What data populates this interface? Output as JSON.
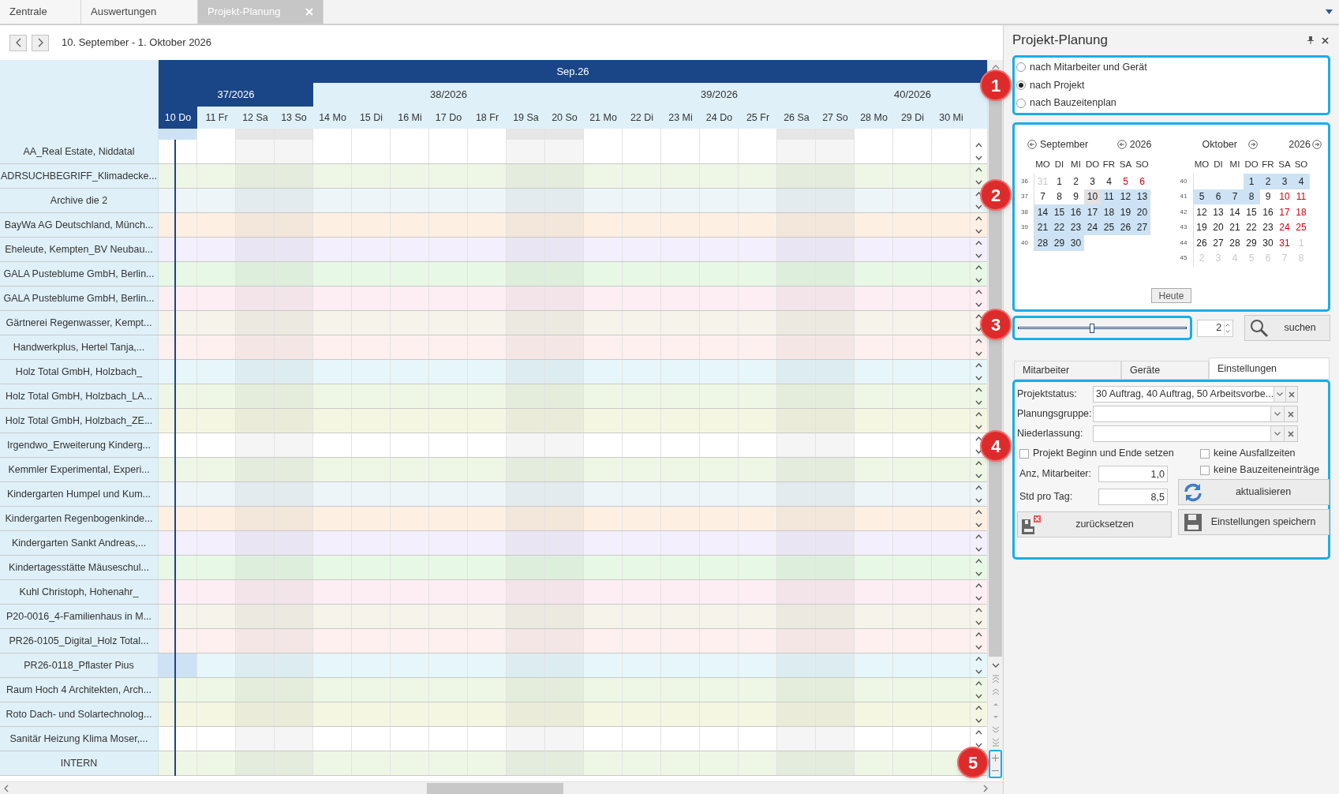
{
  "tabs": [
    {
      "label": "Zentrale",
      "selected": false
    },
    {
      "label": "Auswertungen",
      "selected": false
    },
    {
      "label": "Projekt-Planung",
      "selected": true
    }
  ],
  "toolbar": {
    "range": "10. September - 1. Oktober 2026"
  },
  "gantt": {
    "month": "Sep.26",
    "weeks": [
      {
        "label": "37/2026",
        "current": true,
        "days": [
          {
            "label": "10 Do",
            "weekend": false,
            "today": true
          },
          {
            "label": "11 Fr",
            "weekend": false,
            "today": false
          },
          {
            "label": "12 Sa",
            "weekend": true,
            "today": false
          },
          {
            "label": "13 So",
            "weekend": true,
            "today": false
          }
        ]
      },
      {
        "label": "38/2026",
        "current": false,
        "days": [
          {
            "label": "14 Mo",
            "weekend": false,
            "today": false
          },
          {
            "label": "15 Di",
            "weekend": false,
            "today": false
          },
          {
            "label": "16 Mi",
            "weekend": false,
            "today": false
          },
          {
            "label": "17 Do",
            "weekend": false,
            "today": false
          },
          {
            "label": "18 Fr",
            "weekend": false,
            "today": false
          },
          {
            "label": "19 Sa",
            "weekend": true,
            "today": false
          },
          {
            "label": "20 So",
            "weekend": true,
            "today": false
          }
        ]
      },
      {
        "label": "39/2026",
        "current": false,
        "days": [
          {
            "label": "21 Mo",
            "weekend": false,
            "today": false
          },
          {
            "label": "22 Di",
            "weekend": false,
            "today": false
          },
          {
            "label": "23 Mi",
            "weekend": false,
            "today": false
          },
          {
            "label": "24 Do",
            "weekend": false,
            "today": false
          },
          {
            "label": "25 Fr",
            "weekend": false,
            "today": false
          },
          {
            "label": "26 Sa",
            "weekend": true,
            "today": false
          },
          {
            "label": "27 So",
            "weekend": true,
            "today": false
          }
        ]
      },
      {
        "label": "40/2026",
        "current": false,
        "days": [
          {
            "label": "28 Mo",
            "weekend": false,
            "today": false
          },
          {
            "label": "29 Di",
            "weekend": false,
            "today": false
          },
          {
            "label": "30 Mi",
            "weekend": false,
            "today": false
          }
        ]
      }
    ],
    "rows": [
      {
        "name": "AA_Real Estate, Niddatal",
        "color": "#ffffff",
        "selected": false
      },
      {
        "name": "ADRSUCHBEGRIFF_Klimadecke...",
        "color": "#eef6e6",
        "selected": false
      },
      {
        "name": "Archive die 2",
        "color": "#edf5f8",
        "selected": false
      },
      {
        "name": "BayWa AG Deutschland, Münch...",
        "color": "#fdf0e3",
        "selected": false
      },
      {
        "name": "Eheleute, Kempten_BV Neubau...",
        "color": "#f3effc",
        "selected": false
      },
      {
        "name": "GALA Pusteblume GmbH, Berlin...",
        "color": "#e8f8e6",
        "selected": false
      },
      {
        "name": "GALA Pusteblume GmbH, Berlin...",
        "color": "#fdeef3",
        "selected": false
      },
      {
        "name": "Gärtnerei Regenwasser, Kempt...",
        "color": "#f5f3ea",
        "selected": false
      },
      {
        "name": "Handwerkplus, Hertel Tanja,...",
        "color": "#fdf0ee",
        "selected": false
      },
      {
        "name": "Holz Total GmbH, Holzbach_",
        "color": "#e6f6fa",
        "selected": false
      },
      {
        "name": "Holz Total GmbH, Holzbach_LA...",
        "color": "#eef7e5",
        "selected": false
      },
      {
        "name": "Holz Total GmbH, Holzbach_ZE...",
        "color": "#f4f6e2",
        "selected": false
      },
      {
        "name": "Irgendwo_Erweiterung Kinderg...",
        "color": "#ffffff",
        "selected": false
      },
      {
        "name": "Kemmler Experimental, Experi...",
        "color": "#eef6e6",
        "selected": false
      },
      {
        "name": "Kindergarten Humpel und Kum...",
        "color": "#edf5f8",
        "selected": false
      },
      {
        "name": "Kindergarten Regenbogenkinde...",
        "color": "#fdf0e3",
        "selected": false
      },
      {
        "name": "Kindergarten Sankt Andreas,...",
        "color": "#f3effc",
        "selected": false
      },
      {
        "name": "Kindertagesstätte Mäuseschul...",
        "color": "#e8f8e6",
        "selected": false
      },
      {
        "name": "Kuhl Christoph, Hohenahr_",
        "color": "#fdeef3",
        "selected": false
      },
      {
        "name": "P20-0016_4-Familienhaus in M...",
        "color": "#f5f3ea",
        "selected": false
      },
      {
        "name": "PR26-0105_Digital_Holz Total...",
        "color": "#fdf0ee",
        "selected": false
      },
      {
        "name": "PR26-0118_Pflaster Pius",
        "color": "#e6f6fa",
        "selected": true
      },
      {
        "name": "Raum Hoch 4 Architekten, Arch...",
        "color": "#eef7e5",
        "selected": false
      },
      {
        "name": "Roto Dach- und Solartechnolog...",
        "color": "#f4f6e2",
        "selected": false
      },
      {
        "name": "Sanitär Heizung Klima Moser,...",
        "color": "#ffffff",
        "selected": false
      },
      {
        "name": "INTERN",
        "color": "#eef6e6",
        "selected": false
      }
    ]
  },
  "panel": {
    "title": "Projekt-Planung",
    "views": [
      {
        "label": "nach Mitarbeiter und Gerät",
        "selected": false
      },
      {
        "label": "nach Projekt",
        "selected": true
      },
      {
        "label": "nach Bauzeitenplan",
        "selected": false
      }
    ],
    "calendar": {
      "months": [
        {
          "month": "September",
          "year": "2026",
          "weekdays": [
            "MO",
            "DI",
            "MI",
            "DO",
            "FR",
            "SA",
            "SO"
          ],
          "weeks": [
            {
              "week": "36",
              "days": [
                {
                  "t": "31",
                  "kind": "muted",
                  "selected": false
                },
                {
                  "t": "1",
                  "kind": "plain",
                  "selected": false
                },
                {
                  "t": "2",
                  "kind": "plain",
                  "selected": false
                },
                {
                  "t": "3",
                  "kind": "plain",
                  "selected": false
                },
                {
                  "t": "4",
                  "kind": "plain",
                  "selected": false
                },
                {
                  "t": "5",
                  "kind": "weekend",
                  "selected": false
                },
                {
                  "t": "6",
                  "kind": "weekend",
                  "selected": false
                }
              ]
            },
            {
              "week": "37",
              "days": [
                {
                  "t": "7",
                  "kind": "plain",
                  "selected": false
                },
                {
                  "t": "8",
                  "kind": "plain",
                  "selected": false
                },
                {
                  "t": "9",
                  "kind": "plain",
                  "selected": false
                },
                {
                  "t": "10",
                  "kind": "today",
                  "selected": false
                },
                {
                  "t": "11",
                  "kind": "plain",
                  "selected": true
                },
                {
                  "t": "12",
                  "kind": "weekend",
                  "selected": true
                },
                {
                  "t": "13",
                  "kind": "weekend",
                  "selected": true
                }
              ]
            },
            {
              "week": "38",
              "days": [
                {
                  "t": "14",
                  "kind": "plain",
                  "selected": true
                },
                {
                  "t": "15",
                  "kind": "plain",
                  "selected": true
                },
                {
                  "t": "16",
                  "kind": "plain",
                  "selected": true
                },
                {
                  "t": "17",
                  "kind": "plain",
                  "selected": true
                },
                {
                  "t": "18",
                  "kind": "plain",
                  "selected": true
                },
                {
                  "t": "19",
                  "kind": "weekend",
                  "selected": true
                },
                {
                  "t": "20",
                  "kind": "weekend",
                  "selected": true
                }
              ]
            },
            {
              "week": "39",
              "days": [
                {
                  "t": "21",
                  "kind": "plain",
                  "selected": true
                },
                {
                  "t": "22",
                  "kind": "plain",
                  "selected": true
                },
                {
                  "t": "23",
                  "kind": "plain",
                  "selected": true
                },
                {
                  "t": "24",
                  "kind": "plain",
                  "selected": true
                },
                {
                  "t": "25",
                  "kind": "plain",
                  "selected": true
                },
                {
                  "t": "26",
                  "kind": "weekend",
                  "selected": true
                },
                {
                  "t": "27",
                  "kind": "weekend",
                  "selected": true
                }
              ]
            },
            {
              "week": "40",
              "days": [
                {
                  "t": "28",
                  "kind": "plain",
                  "selected": true
                },
                {
                  "t": "29",
                  "kind": "plain",
                  "selected": true
                },
                {
                  "t": "30",
                  "kind": "plain",
                  "selected": true
                }
              ]
            }
          ]
        },
        {
          "month": "Oktober",
          "year": "2026",
          "weekdays": [
            "MO",
            "DI",
            "MI",
            "DO",
            "FR",
            "SA",
            "SO"
          ],
          "weeks": [
            {
              "week": "40",
              "days": [
                {
                  "t": "1",
                  "kind": "plain",
                  "selected": true
                },
                {
                  "t": "2",
                  "kind": "plain",
                  "selected": true
                },
                {
                  "t": "3",
                  "kind": "weekend",
                  "selected": true
                },
                {
                  "t": "4",
                  "kind": "weekend",
                  "selected": true
                }
              ]
            },
            {
              "week": "41",
              "days": [
                {
                  "t": "5",
                  "kind": "plain",
                  "selected": true
                },
                {
                  "t": "6",
                  "kind": "plain",
                  "selected": true
                },
                {
                  "t": "7",
                  "kind": "plain",
                  "selected": true
                },
                {
                  "t": "8",
                  "kind": "plain",
                  "selected": true
                },
                {
                  "t": "9",
                  "kind": "plain",
                  "selected": false
                },
                {
                  "t": "10",
                  "kind": "weekend",
                  "selected": false
                },
                {
                  "t": "11",
                  "kind": "weekend",
                  "selected": false
                }
              ]
            },
            {
              "week": "42",
              "days": [
                {
                  "t": "12",
                  "kind": "plain",
                  "selected": false
                },
                {
                  "t": "13",
                  "kind": "plain",
                  "selected": false
                },
                {
                  "t": "14",
                  "kind": "plain",
                  "selected": false
                },
                {
                  "t": "15",
                  "kind": "plain",
                  "selected": false
                },
                {
                  "t": "16",
                  "kind": "plain",
                  "selected": false
                },
                {
                  "t": "17",
                  "kind": "weekend",
                  "selected": false
                },
                {
                  "t": "18",
                  "kind": "weekend",
                  "selected": false
                }
              ]
            },
            {
              "week": "43",
              "days": [
                {
                  "t": "19",
                  "kind": "plain",
                  "selected": false
                },
                {
                  "t": "20",
                  "kind": "plain",
                  "selected": false
                },
                {
                  "t": "21",
                  "kind": "plain",
                  "selected": false
                },
                {
                  "t": "22",
                  "kind": "plain",
                  "selected": false
                },
                {
                  "t": "23",
                  "kind": "plain",
                  "selected": false
                },
                {
                  "t": "24",
                  "kind": "weekend",
                  "selected": false
                },
                {
                  "t": "25",
                  "kind": "weekend",
                  "selected": false
                }
              ]
            },
            {
              "week": "44",
              "days": [
                {
                  "t": "26",
                  "kind": "plain",
                  "selected": false
                },
                {
                  "t": "27",
                  "kind": "plain",
                  "selected": false
                },
                {
                  "t": "28",
                  "kind": "plain",
                  "selected": false
                },
                {
                  "t": "29",
                  "kind": "plain",
                  "selected": false
                },
                {
                  "t": "30",
                  "kind": "plain",
                  "selected": false
                },
                {
                  "t": "31",
                  "kind": "weekend",
                  "selected": false
                },
                {
                  "t": "1",
                  "kind": "muted",
                  "selected": false
                }
              ]
            },
            {
              "week": "45",
              "days": [
                {
                  "t": "2",
                  "kind": "muted",
                  "selected": false
                },
                {
                  "t": "3",
                  "kind": "muted",
                  "selected": false
                },
                {
                  "t": "4",
                  "kind": "muted",
                  "selected": false
                },
                {
                  "t": "5",
                  "kind": "muted",
                  "selected": false
                },
                {
                  "t": "6",
                  "kind": "muted",
                  "selected": false
                },
                {
                  "t": "7",
                  "kind": "muted",
                  "selected": false
                },
                {
                  "t": "8",
                  "kind": "muted",
                  "selected": false
                }
              ]
            }
          ]
        }
      ],
      "today_button": "Heute"
    },
    "zoom": {
      "level": 0.44,
      "value": "2"
    },
    "search_button": "suchen",
    "tabs": [
      {
        "label": "Mitarbeiter",
        "selected": false
      },
      {
        "label": "Geräte",
        "selected": false
      },
      {
        "label": "Einstellungen",
        "selected": true
      }
    ],
    "settings": {
      "combos": [
        {
          "label": "Projektstatus:",
          "value": "30 Auftrag, 40 Auftrag, 50 Arbeitsvorbe..."
        },
        {
          "label": "Planungsgruppe:"
        },
        {
          "label": "Niederlassung:"
        }
      ],
      "left_checks": [
        {
          "label": "Projekt Beginn und Ende setzen",
          "checked": false
        }
      ],
      "right_checks": [
        {
          "label": "keine Ausfallzeiten",
          "checked": false
        },
        {
          "label": "keine Bauzeiteneinträge",
          "checked": false
        }
      ],
      "numbers": [
        {
          "label": "Anz, Mitarbeiter:",
          "value": "1,0"
        },
        {
          "label": "Std pro Tag:",
          "value": "8,5"
        }
      ],
      "refresh_button": "aktualisieren",
      "reset_button": "zurücksetzen",
      "save_button": "Einstellungen speichern"
    }
  },
  "callouts": [
    "1",
    "2",
    "3",
    "4",
    "5"
  ]
}
